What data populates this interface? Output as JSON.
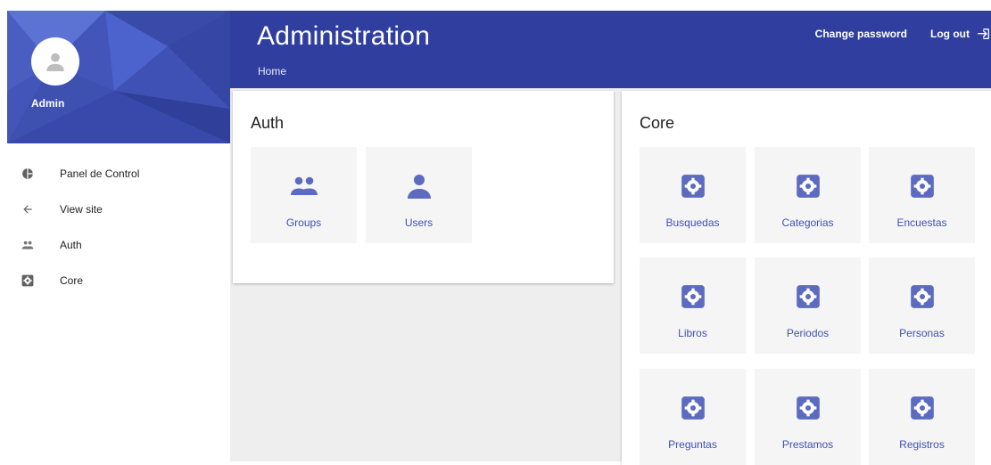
{
  "colors": {
    "primary": "#303f9f",
    "accent": "#3f51b5",
    "tile_icon": "#5c6bc0",
    "tile_bg": "#f5f5f5",
    "main_bg": "#eeeeee"
  },
  "sidebar": {
    "username": "Admin",
    "avatar_icon": "person-icon",
    "nav": [
      {
        "label": "Panel de Control",
        "icon": "pie-chart-icon"
      },
      {
        "label": "View site",
        "icon": "arrow-left-icon"
      },
      {
        "label": "Auth",
        "icon": "people-icon"
      },
      {
        "label": "Core",
        "icon": "gear-box-icon"
      }
    ]
  },
  "header": {
    "title": "Administration",
    "breadcrumb": "Home",
    "change_password": "Change password",
    "logout": "Log out",
    "logout_icon": "logout-icon"
  },
  "apps": {
    "auth": {
      "title": "Auth",
      "models": [
        {
          "label": "Groups",
          "icon": "people-icon"
        },
        {
          "label": "Users",
          "icon": "person-icon"
        }
      ]
    },
    "core": {
      "title": "Core",
      "models": [
        {
          "label": "Busquedas",
          "icon": "gear-box-icon"
        },
        {
          "label": "Categorias",
          "icon": "gear-box-icon"
        },
        {
          "label": "Encuestas",
          "icon": "gear-box-icon"
        },
        {
          "label": "Libros",
          "icon": "gear-box-icon"
        },
        {
          "label": "Periodos",
          "icon": "gear-box-icon"
        },
        {
          "label": "Personas",
          "icon": "gear-box-icon"
        },
        {
          "label": "Preguntas",
          "icon": "gear-box-icon"
        },
        {
          "label": "Prestamos",
          "icon": "gear-box-icon"
        },
        {
          "label": "Registros",
          "icon": "gear-box-icon"
        }
      ]
    }
  }
}
